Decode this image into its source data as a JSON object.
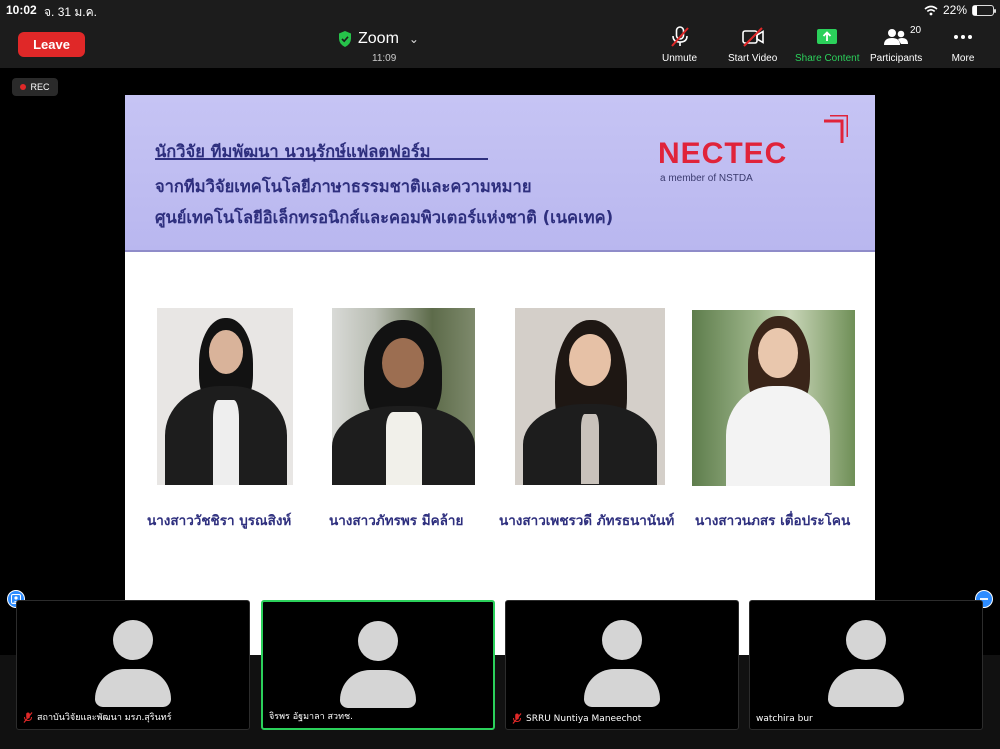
{
  "status_bar": {
    "time": "10:02",
    "date": "จ. 31 ม.ค.",
    "battery": "22%",
    "battery_level": 0.22,
    "wifi_icon": "wifi-icon"
  },
  "toolbar": {
    "leave_label": "Leave",
    "meeting_name": "Zoom",
    "elapsed": "11:09",
    "unmute_label": "Unmute",
    "start_video_label": "Start Video",
    "share_label": "Share Content",
    "participants_label": "Participants",
    "participants_count": "20",
    "more_label": "More"
  },
  "rec_label": "REC",
  "slide": {
    "heading_line1": "นักวิจัย ทีมพัฒนา นวนุรักษ์แฟลตฟอร์ม",
    "heading_line2": "จากทีมวิจัยเทคโนโลยีภาษาธรรมชาติและความหมาย",
    "heading_line3": "ศูนย์เทคโนโลยีอิเล็กทรอนิกส์และคอมพิวเตอร์แห่งชาติ (เนคเทค)",
    "logo_text": "NECTEC",
    "logo_subtext": "a member of NSTDA",
    "people": [
      {
        "name": "นางสาววัชชิรา บูรณสิงห์"
      },
      {
        "name": "นางสาวภัทรพร มีคล้าย"
      },
      {
        "name": "นางสาวเพชรวดี ภัทรธนานันท์"
      },
      {
        "name": "นางสาวนภสร เตื่อประโคน"
      }
    ]
  },
  "participants": [
    {
      "name": "สถาบันวิจัยและพัฒนา มรภ.สุรินทร์",
      "muted": true
    },
    {
      "name": "จิรพร อัฐมาลา สวทช.",
      "muted": false
    },
    {
      "name": "SRRU Nuntiya Maneechot",
      "muted": true
    },
    {
      "name": "watchira bur",
      "muted": false
    }
  ],
  "colors": {
    "leave": "#e02828",
    "share": "#2bd05b",
    "slide_text": "#2e2f7e",
    "nectec_red": "#e0233a"
  }
}
